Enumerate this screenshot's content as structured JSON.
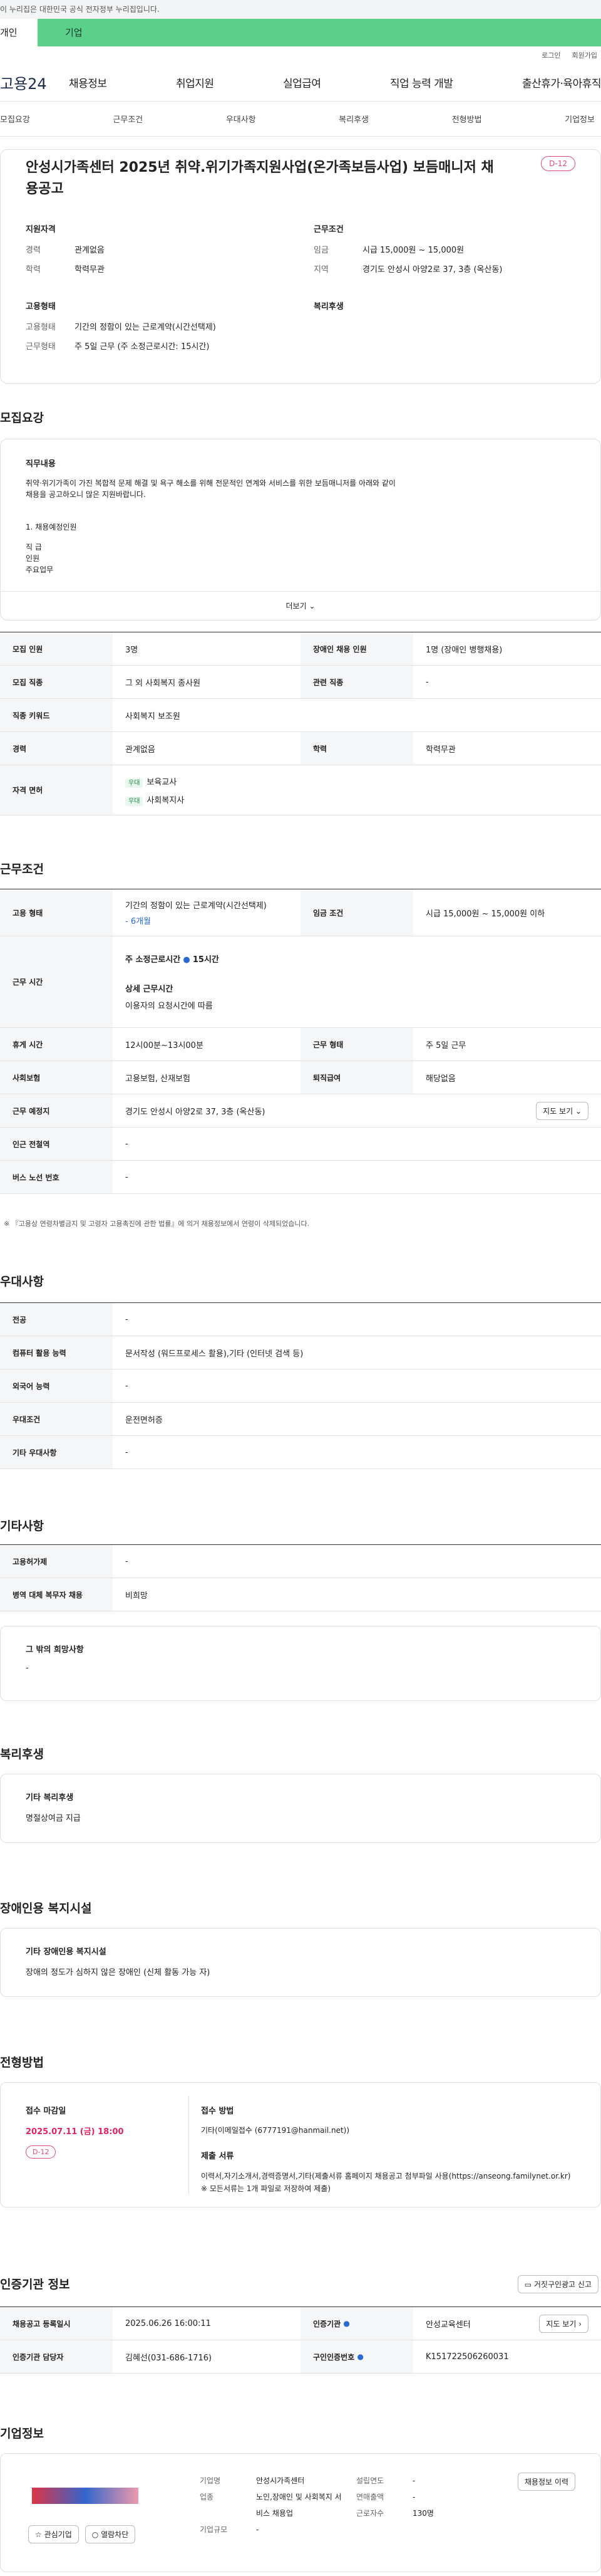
{
  "gov_notice": "이 누리집은 대한민국 공식 전자정부 누리집입니다.",
  "portal_tabs": [
    "개인",
    "기업"
  ],
  "util": [
    "로그인",
    "회원가입"
  ],
  "logo": "고용24",
  "gnb": [
    "채용정보",
    "취업지원",
    "실업급여",
    "직업 능력 개발",
    "출산휴가·육아휴직"
  ],
  "snb": [
    "모집요강",
    "근무조건",
    "우대사항",
    "복리후생",
    "전형방법",
    "기업정보"
  ],
  "job_title": "안성시가족센터 2025년 취약.위기가족지원사업(온가족보듬사업) 보듬매니저 채용공고",
  "dday": "D-12",
  "summary": {
    "qual_h": "지원자격",
    "cond_h": "근무조건",
    "type_h": "고용형태",
    "welfare_h": "복리후생",
    "career_k": "경력",
    "career_v": "관계없음",
    "edu_k": "학력",
    "edu_v": "학력무관",
    "wage_k": "임금",
    "wage_v": "시급 15,000원 ~ 15,000원",
    "region_k": "지역",
    "region_v": "경기도 안성시 아양2로 37, 3층 (옥산동)",
    "emp_k": "고용형태",
    "emp_v": "기간의 정함이 있는 근로계약(시간선택제)",
    "work_k": "근무형태",
    "work_v": "주 5일 근무 (주 소정근로시간: 15시간)"
  },
  "recruit": {
    "heading": "모집요강",
    "duty_h": "직무내용",
    "duty_text": "취약·위기가족이 가진 복합적 문제 해결 및 욕구 해소를 위해 전문적인 연계와 서비스를 위한 보듬매니저를 아래와 같이 채용을 공고하오니 많은 지원바랍니다.",
    "duty_lines": [
      "1. 채용예정인원",
      "직   급",
      "인원",
      "주요업무"
    ],
    "more": "더보기",
    "rows": [
      [
        "모집 인원",
        "3명",
        "장애인 채용 인원",
        "1명 (장애인 병행채용)"
      ],
      [
        "모집 직종",
        "그 외 사회복지 종사원",
        "관련 직종",
        "-"
      ],
      [
        "직종 키워드",
        "사회복지 보조원",
        "",
        ""
      ],
      [
        "경력",
        "관계없음",
        "학력",
        "학력무관"
      ]
    ],
    "license_h": "자격 면허",
    "license_badge": "우대",
    "licenses": [
      "보육교사",
      "사회복지사"
    ]
  },
  "work": {
    "heading": "근무조건",
    "type_k": "고용 형태",
    "type_v": "기간의 정함이 있는 근로계약(시간선택제)",
    "type_sub": "- 6개월",
    "wage_k": "임금 조건",
    "wage_v": "시급 15,000원 ~ 15,000원 이하",
    "hours_k": "근무 시간",
    "hours_a": "주 소정근로시간",
    "hours_b": "15시간",
    "hours_c": "상세 근무시간",
    "hours_d": "이용자의 요청시간에 따름",
    "rows": [
      [
        "휴게 시간",
        "12시00분~13시00분",
        "근무 형태",
        "주 5일 근무"
      ],
      [
        "사회보험",
        "고용보험, 산재보험",
        "퇴직급여",
        "해당없음"
      ]
    ],
    "place_k": "근무 예정지",
    "place_v": "경기도 안성시 아양2로 37, 3층 (옥산동)",
    "map": "지도 보기",
    "station_k": "인근 전철역",
    "station_v": "-",
    "bus_k": "버스 노선 번호",
    "bus_v": "-",
    "note": "※ 『고용상 연령차별금지 및 고령자 고용촉진에 관한 법률』에 의거 채용정보에서 연령이 삭제되었습니다."
  },
  "pref": {
    "heading": "우대사항",
    "rows": [
      [
        "전공",
        "-"
      ],
      [
        "컴퓨터 활용 능력",
        "문서작성 (워드프로세스 활용),기타 (인터넷 검색 등)"
      ],
      [
        "외국어 능력",
        "-"
      ],
      [
        "우대조건",
        "운전면허증"
      ],
      [
        "기타 우대사항",
        "-"
      ]
    ]
  },
  "etc": {
    "heading": "기타사항",
    "rows": [
      [
        "고용허가제",
        "-"
      ],
      [
        "병역 대체 복무자 채용",
        "비희망"
      ]
    ],
    "wish_h": "그 밖의 희망사항",
    "wish_v": "-"
  },
  "welfare": {
    "heading": "복리후생",
    "h": "기타 복리후생",
    "v": "명절상여금 지급"
  },
  "disability": {
    "heading": "장애인용 복지시설",
    "h": "기타 장애인용 복지시설",
    "v": "장애의 정도가 심하지 않은 장애인 (신체 활동 가능 자)"
  },
  "process": {
    "heading": "전형방법",
    "deadline_h": "접수 마감일",
    "deadline_v": "2025.07.11 (금) 18:00",
    "dday": "D-12",
    "method_h": "접수 방법",
    "method_v": "기타(이메일접수 (6777191@hanmail.net))",
    "docs_h": "제출 서류",
    "docs_v": "이력서,자기소개서,경력증명서,기타(제출서류  홈페이지 채용공고 첨부파일 사용(https://anseong.familynet.or.kr)  ※ 모든서류는 1개 파일로 저장하여 제출)"
  },
  "cert": {
    "heading": "인증기관 정보",
    "report": "거짓구인광고 신고",
    "rows": [
      [
        "채용공고 등록일시",
        "2025.06.26 16:00:11",
        "인증기관",
        "안성교육센터"
      ],
      [
        "인증기관 담당자",
        "김혜선(031-686-1716)",
        "구인인증번호",
        "K151722506260031"
      ]
    ],
    "map": "지도 보기"
  },
  "company": {
    "heading": "기업정보",
    "fav": "관심기업",
    "follow": "열람차단",
    "fields": [
      [
        "기업명",
        "안성시가족센터",
        "설립연도",
        "-"
      ],
      [
        "업종",
        "비스 채용업",
        "연매출액",
        "-"
      ],
      [
        "",
        "",
        "근로자수",
        "130명"
      ],
      [
        "기업규모",
        "-",
        "",
        ""
      ]
    ],
    "history": "채용정보 이력",
    "line2": "노인,장애인 및 사회복지 서"
  }
}
